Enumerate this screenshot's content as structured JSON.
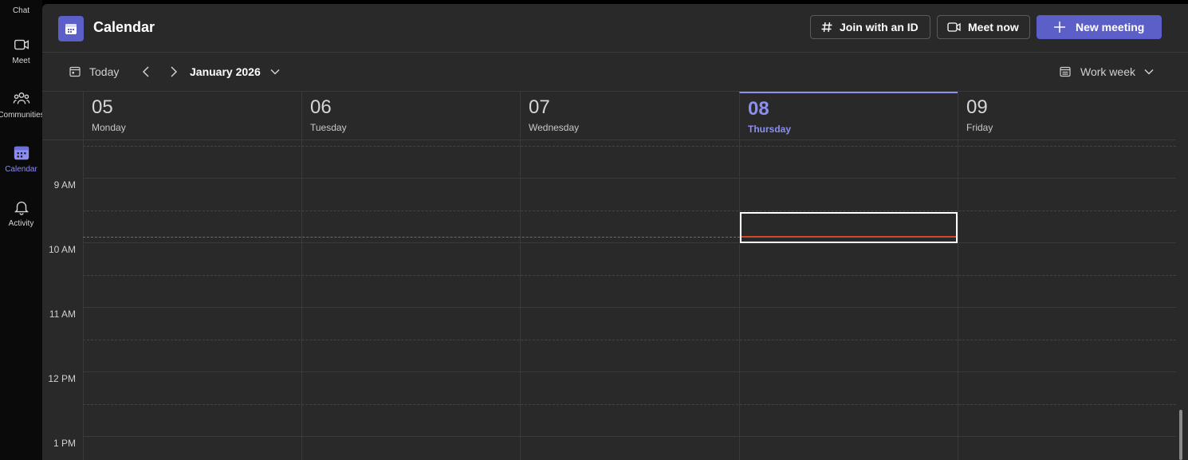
{
  "rail": {
    "items": [
      {
        "label": "Chat",
        "icon": "chat-icon",
        "active": false
      },
      {
        "label": "Meet",
        "icon": "video-camera-icon",
        "active": false
      },
      {
        "label": "Communities",
        "icon": "people-group-icon",
        "active": false
      },
      {
        "label": "Calendar",
        "icon": "calendar-icon",
        "active": true
      },
      {
        "label": "Activity",
        "icon": "bell-icon",
        "active": false
      }
    ]
  },
  "header": {
    "title": "Calendar",
    "join_label": "Join with an ID",
    "meet_now_label": "Meet now",
    "new_meeting_label": "New meeting"
  },
  "toolbar": {
    "today_label": "Today",
    "month_label": "January 2026",
    "view_label": "Work week"
  },
  "days": [
    {
      "num": "05",
      "name": "Monday",
      "today": false
    },
    {
      "num": "06",
      "name": "Tuesday",
      "today": false
    },
    {
      "num": "07",
      "name": "Wednesday",
      "today": false
    },
    {
      "num": "08",
      "name": "Thursday",
      "today": true
    },
    {
      "num": "09",
      "name": "Friday",
      "today": false
    }
  ],
  "times": [
    "9 AM",
    "10 AM",
    "11 AM",
    "12 PM",
    "1 PM"
  ],
  "colors": {
    "accent": "#5b5fc7",
    "accent_text": "#8c8ff0",
    "now_line": "#d6452b",
    "background": "#292929"
  }
}
